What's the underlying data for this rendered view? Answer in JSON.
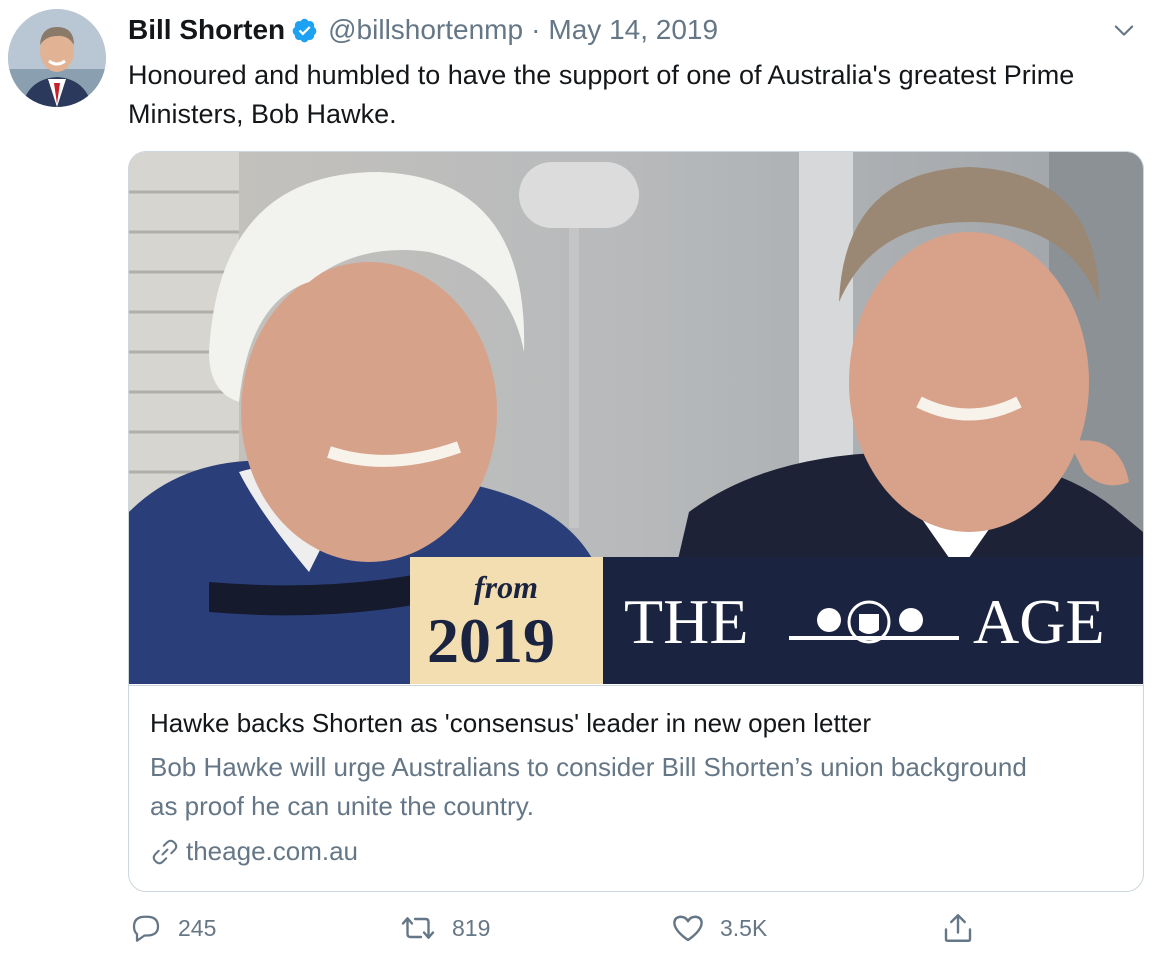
{
  "tweet": {
    "author_name": "Bill Shorten",
    "handle": "@billshortenmp",
    "separator": "·",
    "date": "May 14, 2019",
    "text": "Honoured and humbled to have the support of one of Australia's greatest Prime Ministers, Bob Hawke.",
    "verified_icon": "verified-badge-icon",
    "menu_icon": "chevron-down-icon"
  },
  "card": {
    "image_badge_from": "from",
    "image_badge_year": "2019",
    "image_masthead_left": "THE",
    "image_masthead_right": "AGE",
    "title": "Hawke backs Shorten as 'consensus' leader in new open letter",
    "description": "Bob Hawke will urge Australians to consider Bill Shorten’s union background as proof he can unite the country.",
    "domain": "theage.com.au",
    "link_icon": "link-icon"
  },
  "actions": {
    "replies": "245",
    "retweets": "819",
    "likes": "3.5K",
    "reply_icon": "reply-icon",
    "retweet_icon": "retweet-icon",
    "like_icon": "heart-icon",
    "share_icon": "share-icon"
  },
  "colors": {
    "text_primary": "#14171a",
    "text_secondary": "#657786",
    "border": "#ccd6dd",
    "verified_blue": "#1da1f2",
    "masthead_navy": "#1a2340",
    "badge_cream": "#f2deb0"
  }
}
